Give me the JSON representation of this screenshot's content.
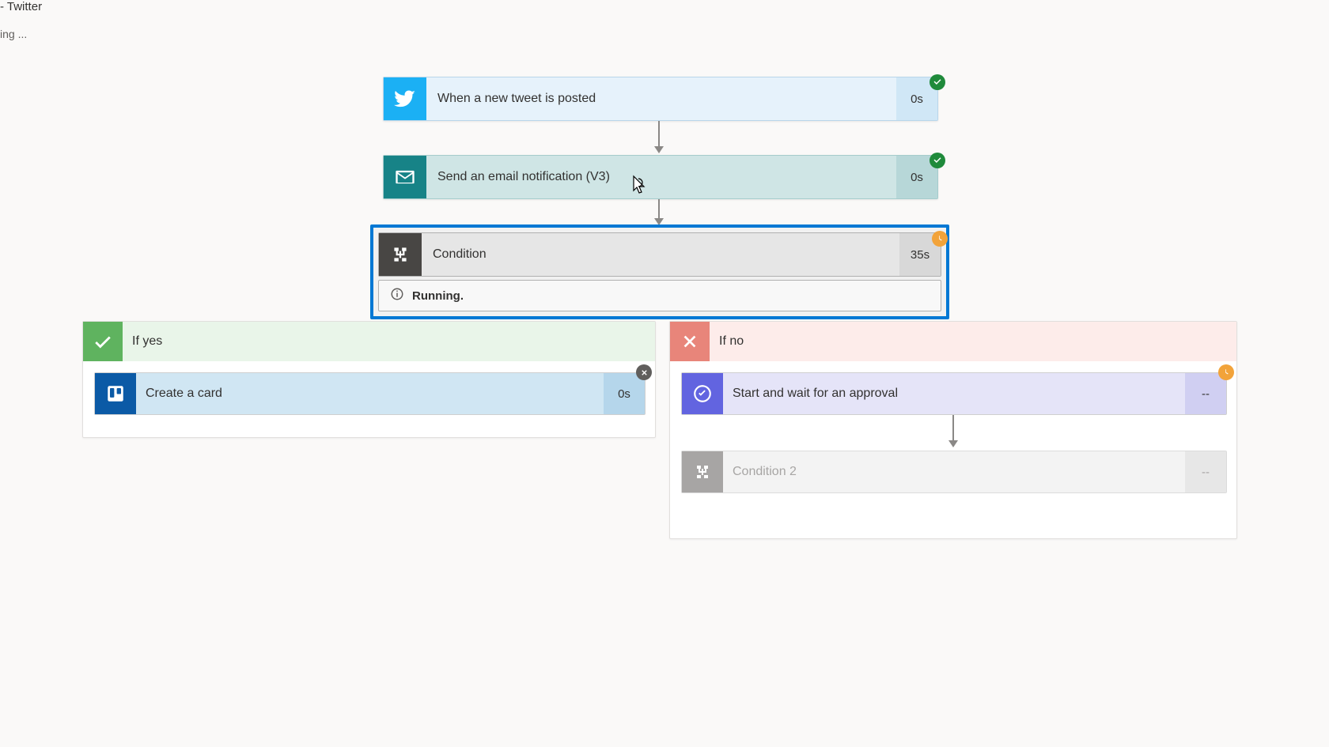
{
  "window": {
    "title_suffix": "- Twitter",
    "loading_text": "ing ..."
  },
  "flow": {
    "trigger": {
      "label": "When a new tweet is posted",
      "duration": "0s",
      "status": "success"
    },
    "email": {
      "label": "Send an email notification (V3)",
      "duration": "0s",
      "status": "success"
    },
    "condition": {
      "label": "Condition",
      "duration": "35s",
      "status": "running",
      "status_text": "Running."
    },
    "yes_branch": {
      "header": "If yes",
      "trello": {
        "label": "Create a card",
        "duration": "0s",
        "status": "cancelled"
      }
    },
    "no_branch": {
      "header": "If no",
      "approval": {
        "label": "Start and wait for an approval",
        "duration": "--",
        "status": "pending"
      },
      "condition2": {
        "label": "Condition 2",
        "duration": "--"
      }
    }
  }
}
